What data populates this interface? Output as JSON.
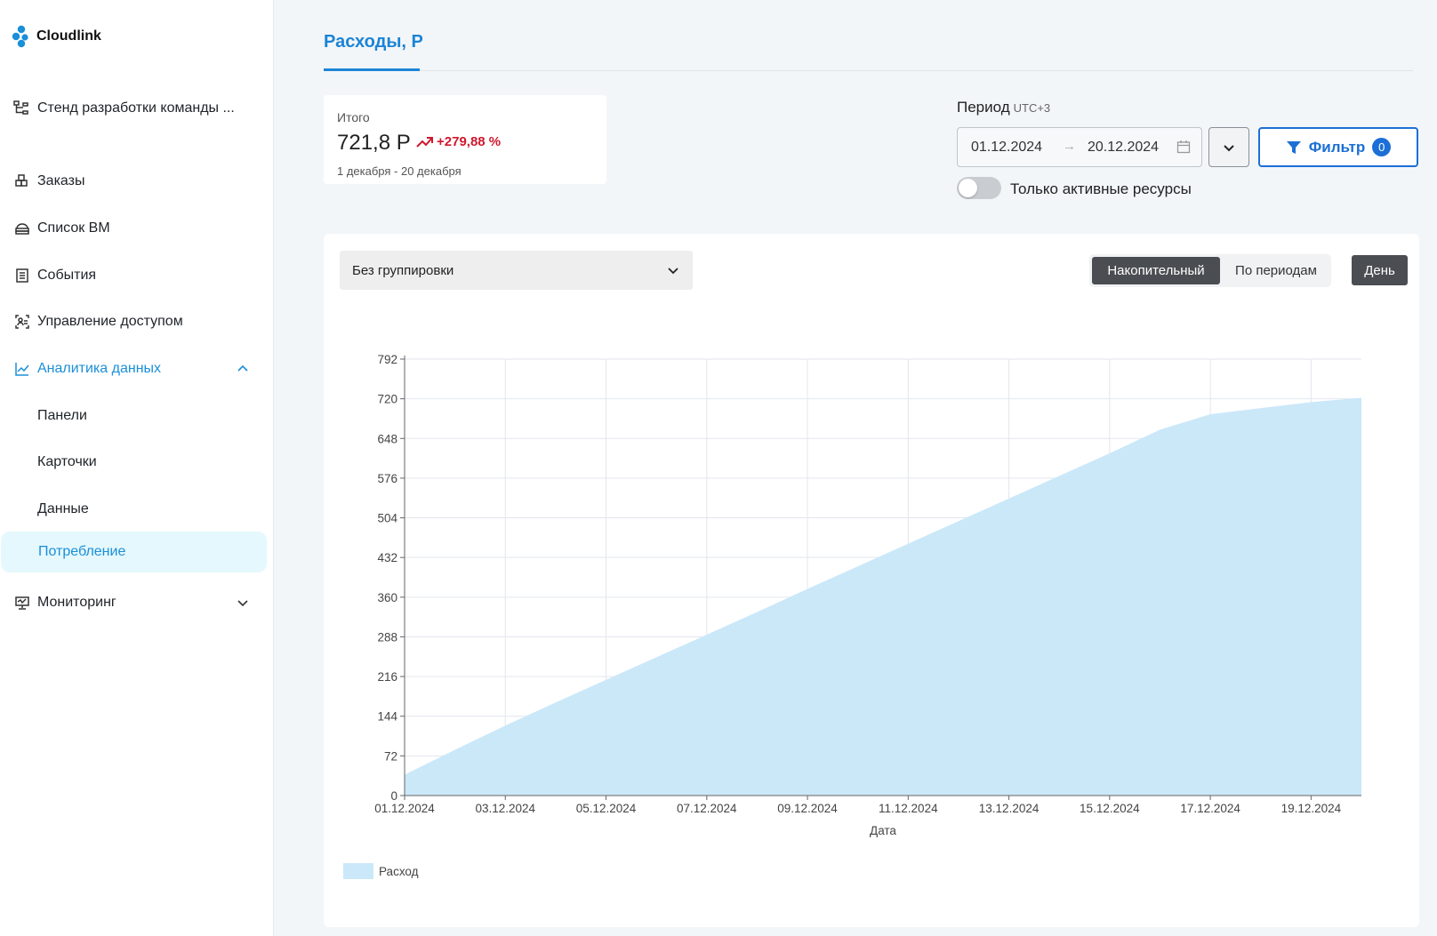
{
  "sidebar": {
    "logo_text": "Cloudlink",
    "project_name": "Стенд разработки команды ...",
    "items": [
      {
        "label": "Заказы",
        "icon": "orders-icon"
      },
      {
        "label": "Список ВМ",
        "icon": "vm-list-icon"
      },
      {
        "label": "События",
        "icon": "events-icon"
      },
      {
        "label": "Управление доступом",
        "icon": "access-icon"
      },
      {
        "label": "Аналитика данных",
        "icon": "analytics-icon",
        "expanded": true
      },
      {
        "label": "Панели"
      },
      {
        "label": "Карточки"
      },
      {
        "label": "Данные"
      },
      {
        "label": "Потребление",
        "active": true
      },
      {
        "label": "Мониторинг",
        "icon": "monitoring-icon",
        "expanded": false
      }
    ],
    "accent_color": "#1b8fd8"
  },
  "header": {
    "title": "Расходы, Р"
  },
  "summary": {
    "caption": "Итого",
    "total": "721,8 Р",
    "change": "+279,88 %",
    "range": "1 декабря - 20 декабря",
    "change_color": "#d0182d"
  },
  "period": {
    "label": "Период",
    "timezone": "UTC+3",
    "date_from": "01.12.2024",
    "arrow": "→",
    "date_to": "20.12.2024"
  },
  "filter": {
    "label": "Фильтр",
    "count": "0"
  },
  "active_toggle": {
    "label": "Только активные ресурсы",
    "on": false
  },
  "chart_controls": {
    "grouping": "Без группировки",
    "modes": [
      "Накопительный",
      "По периодам"
    ],
    "selected_mode": "Накопительный",
    "granularity": "День"
  },
  "chart_data": {
    "type": "area",
    "xlabel": "Дата",
    "ylabel": "",
    "x": [
      "01.12.2024",
      "02.12.2024",
      "03.12.2024",
      "04.12.2024",
      "05.12.2024",
      "06.12.2024",
      "07.12.2024",
      "08.12.2024",
      "09.12.2024",
      "10.12.2024",
      "11.12.2024",
      "12.12.2024",
      "13.12.2024",
      "14.12.2024",
      "15.12.2024",
      "16.12.2024",
      "17.12.2024",
      "18.12.2024",
      "19.12.2024",
      "20.12.2024"
    ],
    "x_ticks": [
      "01.12.2024",
      "03.12.2024",
      "05.12.2024",
      "07.12.2024",
      "09.12.2024",
      "11.12.2024",
      "13.12.2024",
      "15.12.2024",
      "17.12.2024",
      "19.12.2024"
    ],
    "series": [
      {
        "name": "Расход",
        "color": "#cbe8f9",
        "values": [
          38,
          83,
          127,
          169,
          210,
          251,
          292,
          333,
          375,
          416,
          457,
          498,
          539,
          580,
          621,
          664,
          692,
          703,
          714,
          721.8
        ]
      }
    ],
    "ylim": [
      0,
      792
    ],
    "y_ticks": [
      0,
      72,
      144,
      216,
      288,
      360,
      432,
      504,
      576,
      648,
      720,
      792
    ],
    "grid": true,
    "legend": "bottom-left"
  }
}
